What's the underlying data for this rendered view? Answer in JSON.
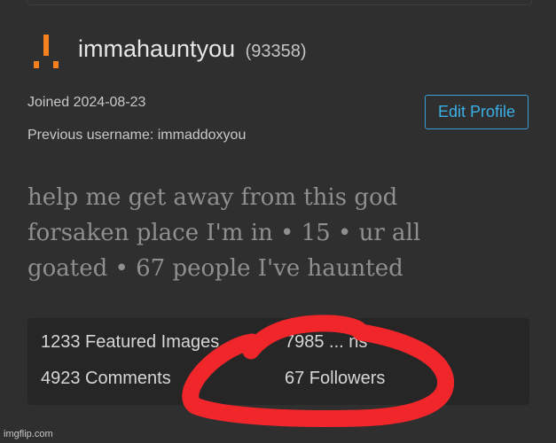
{
  "profile": {
    "username": "immahauntyou",
    "user_id": "(93358)",
    "joined": "Joined 2024-08-23",
    "previous_username": "Previous username: immaddoxyou",
    "edit_button": "Edit Profile",
    "bio_lines": [
      "help me get away from this god",
      "forsaken place I'm in • 15 • ur all",
      "goated • 67 people I've haunted"
    ]
  },
  "stats": {
    "featured_images": "1233 Featured Images",
    "points_partial": "7985 ... ns",
    "comments": "4923 Comments",
    "followers": "67 Followers"
  },
  "annotation": {
    "scribble_color": "#f0262b"
  },
  "watermark": "imgflip.com",
  "colors": {
    "background": "#2f2f2f",
    "panel": "#262626",
    "accent": "#3ab0e6",
    "logo": "#f5821f"
  }
}
